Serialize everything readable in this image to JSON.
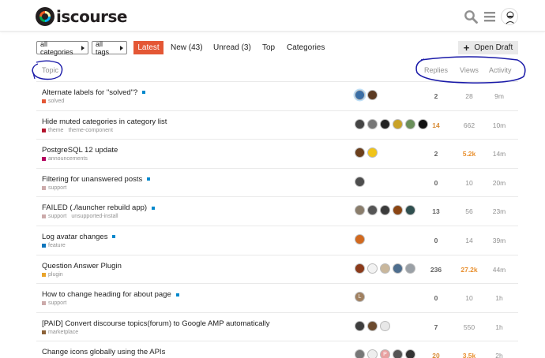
{
  "brand": {
    "name": "iscourse"
  },
  "filters": {
    "categories": "all categories",
    "tags": "all tags"
  },
  "nav": [
    {
      "label": "Latest",
      "active": true
    },
    {
      "label": "New (43)",
      "active": false
    },
    {
      "label": "Unread (3)",
      "active": false
    },
    {
      "label": "Top",
      "active": false
    },
    {
      "label": "Categories",
      "active": false
    }
  ],
  "open_draft": "Open Draft",
  "columns": {
    "topic": "Topic",
    "replies": "Replies",
    "views": "Views",
    "activity": "Activity"
  },
  "colors": {
    "accent": "#e45735",
    "new_dot": "#0088cc",
    "annotation": "#1a1aa8",
    "hot_views": "#e9902f"
  },
  "topics": [
    {
      "title": "Alternate labels for \"solved\"?",
      "unseen": true,
      "categories": [
        {
          "name": "solved",
          "color": "#e45735"
        }
      ],
      "posters": [
        {
          "bg": "#3a6ea5",
          "letter": "",
          "op": true
        },
        {
          "bg": "#5b3a22",
          "letter": ""
        }
      ],
      "replies": "2",
      "views": "28",
      "activity": "9m"
    },
    {
      "title": "Hide muted categories in category list",
      "unseen": false,
      "categories": [
        {
          "name": "theme",
          "color": "#b3132c"
        },
        {
          "name": "theme-component",
          "color": ""
        }
      ],
      "posters": [
        {
          "bg": "#444",
          "letter": ""
        },
        {
          "bg": "#777",
          "letter": ""
        },
        {
          "bg": "#222",
          "letter": ""
        },
        {
          "bg": "#c9a227",
          "letter": ""
        },
        {
          "bg": "#6a8f5a",
          "letter": ""
        },
        {
          "bg": "#111",
          "letter": ""
        }
      ],
      "replies": "14",
      "replies_hot": true,
      "views": "662",
      "activity": "10m"
    },
    {
      "title": "PostgreSQL 12 update",
      "unseen": false,
      "categories": [
        {
          "name": "announcements",
          "color": "#b3005e"
        }
      ],
      "posters": [
        {
          "bg": "#6b3f1c",
          "letter": ""
        },
        {
          "bg": "#f0c419",
          "letter": ""
        }
      ],
      "replies": "2",
      "views": "5.2k",
      "views_hot": true,
      "activity": "14m"
    },
    {
      "title": "Filtering for unanswered posts",
      "unseen": true,
      "categories": [
        {
          "name": "support",
          "color": "#ccaaaa"
        }
      ],
      "posters": [
        {
          "bg": "#4d4d4d",
          "letter": ""
        }
      ],
      "replies": "0",
      "views": "10",
      "activity": "20m"
    },
    {
      "title": "FAILED (./launcher rebuild app)",
      "unseen": true,
      "categories": [
        {
          "name": "support",
          "color": "#ccaaaa"
        },
        {
          "name": "unsupported-install",
          "color": ""
        }
      ],
      "posters": [
        {
          "bg": "#8a7d6b",
          "letter": ""
        },
        {
          "bg": "#555",
          "letter": ""
        },
        {
          "bg": "#3b3b3b",
          "letter": ""
        },
        {
          "bg": "#8b4513",
          "letter": ""
        },
        {
          "bg": "#2f4f4f",
          "letter": ""
        }
      ],
      "replies": "13",
      "views": "56",
      "activity": "23m"
    },
    {
      "title": "Log avatar changes",
      "unseen": true,
      "categories": [
        {
          "name": "feature",
          "color": "#0e76bd"
        }
      ],
      "posters": [
        {
          "bg": "#d2691e",
          "letter": ""
        }
      ],
      "replies": "0",
      "views": "14",
      "activity": "39m"
    },
    {
      "title": "Question Answer Plugin",
      "unseen": false,
      "categories": [
        {
          "name": "plugin",
          "color": "#e9a42b"
        }
      ],
      "posters": [
        {
          "bg": "#8b3a1a",
          "letter": ""
        },
        {
          "bg": "#f2f2f2",
          "letter": ""
        },
        {
          "bg": "#c9b79c",
          "letter": ""
        },
        {
          "bg": "#4e6e8e",
          "letter": ""
        },
        {
          "bg": "#9aa0a6",
          "letter": ""
        }
      ],
      "replies": "236",
      "views": "27.2k",
      "views_hot": true,
      "activity": "44m"
    },
    {
      "title": "How to change heading for about page",
      "unseen": true,
      "categories": [
        {
          "name": "support",
          "color": "#ccaaaa"
        }
      ],
      "posters": [
        {
          "bg": "#a08060",
          "letter": "L"
        }
      ],
      "replies": "0",
      "views": "10",
      "activity": "1h"
    },
    {
      "title": "[PAID] Convert discourse topics(forum) to Google AMP automatically",
      "unseen": false,
      "categories": [
        {
          "name": "marketplace",
          "color": "#8c6238"
        }
      ],
      "posters": [
        {
          "bg": "#3d3d3d",
          "letter": ""
        },
        {
          "bg": "#6b4a2e",
          "letter": ""
        },
        {
          "bg": "#e8e8e8",
          "letter": ""
        }
      ],
      "replies": "7",
      "views": "550",
      "activity": "1h"
    },
    {
      "title": "Change icons globally using the APIs",
      "unseen": false,
      "categories": [],
      "posters": [
        {
          "bg": "#777",
          "letter": ""
        },
        {
          "bg": "#eee",
          "letter": ""
        },
        {
          "bg": "#e8a0a0",
          "letter": "P"
        },
        {
          "bg": "#555",
          "letter": ""
        },
        {
          "bg": "#333",
          "letter": ""
        }
      ],
      "replies": "20",
      "replies_hot": true,
      "views": "3.5k",
      "views_hot": true,
      "activity": "2h"
    }
  ]
}
